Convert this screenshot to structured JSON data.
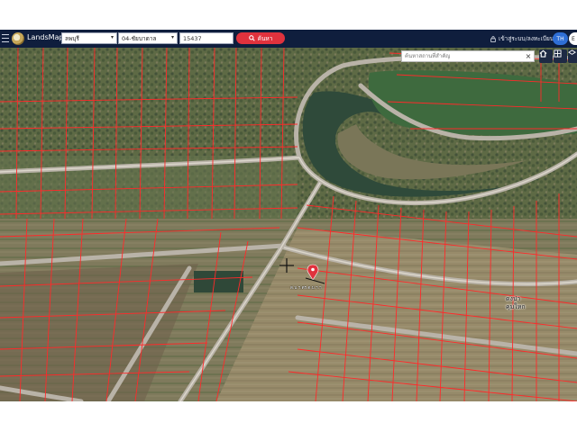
{
  "app": {
    "title": "LandsMaps"
  },
  "toolbar": {
    "province": "ลพบุรี",
    "district": "04-ชัยบาดาล",
    "parcel_number": "15437",
    "search_label": "ค้นหา"
  },
  "account": {
    "login_label": "เข้าสู่ระบบ/ลงทะเบียน"
  },
  "language": {
    "active": "TH",
    "alternate": "E"
  },
  "map": {
    "place_search_placeholder": "ค้นหาสถานที่สำคัญ",
    "clear_glyph": "×",
    "marker_label": "ต.บ.ฯ.ตร.ต.บ.ฯ.ฯ",
    "area_label_line1": "ดงปา",
    "area_label_line2": "คุมใหก"
  },
  "colors": {
    "navbar": "#0f1e3d",
    "search_button": "#e0323d",
    "parcel_lines": "#ff2a2a",
    "marker": "#e0323d",
    "language_active": "#2f6fd6"
  }
}
